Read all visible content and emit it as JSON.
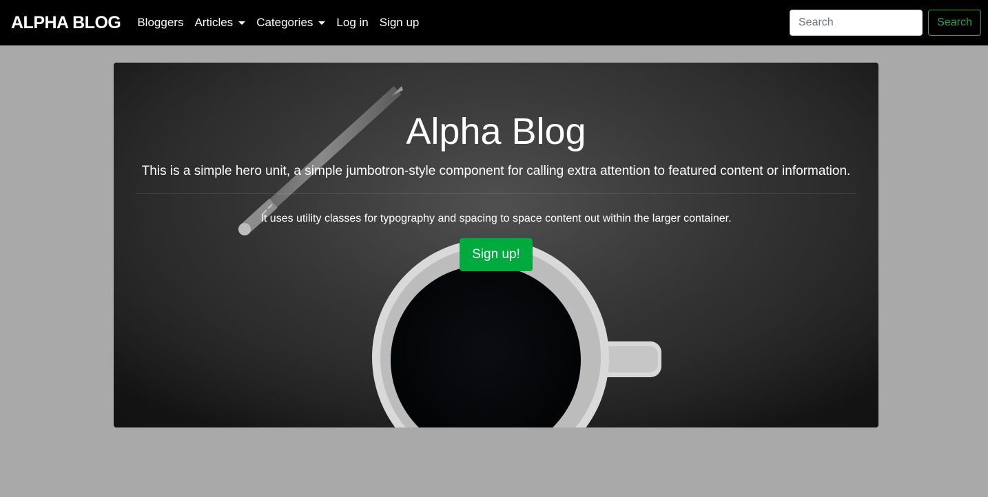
{
  "navbar": {
    "brand": "ALPHA BLOG",
    "links": [
      {
        "label": "Bloggers",
        "dropdown": false
      },
      {
        "label": "Articles",
        "dropdown": true
      },
      {
        "label": "Categories",
        "dropdown": true
      },
      {
        "label": "Log in",
        "dropdown": false
      },
      {
        "label": "Sign up",
        "dropdown": false
      }
    ],
    "search": {
      "placeholder": "Search",
      "value": "",
      "button_label": "Search"
    }
  },
  "hero": {
    "title": "Alpha Blog",
    "lead": "This is a simple hero unit, a simple jumbotron-style component for calling extra attention to featured content or information.",
    "subtext": "It uses utility classes for typography and spacing to space content out within the larger container.",
    "button_label": "Sign up!"
  },
  "colors": {
    "navbar_bg": "#000000",
    "page_bg": "#a9a9a9",
    "accent_green": "#28a745",
    "signup_green": "#00aa3c"
  },
  "icons": [
    "caret-down-icon"
  ]
}
